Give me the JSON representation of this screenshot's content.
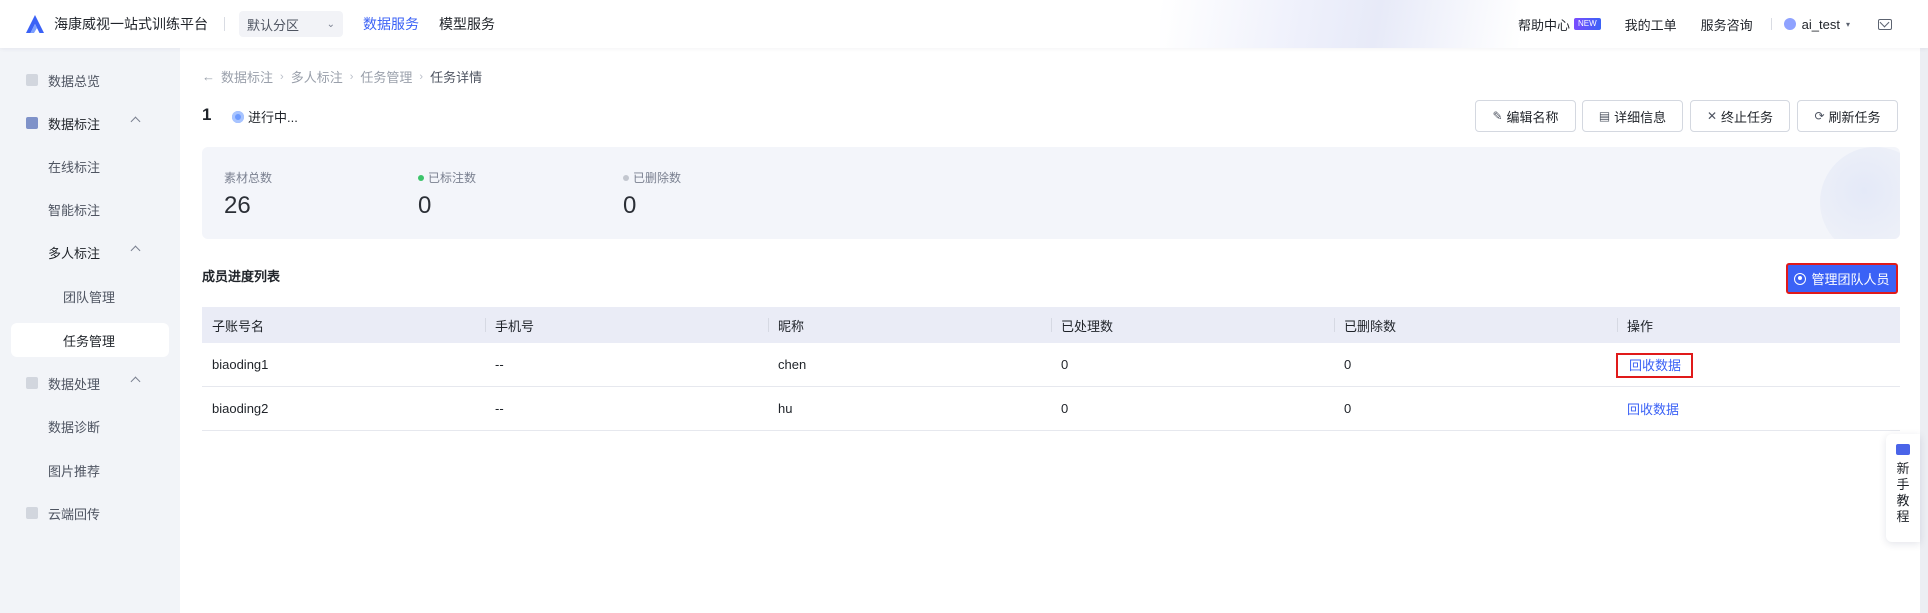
{
  "header": {
    "app_title": "海康威视一站式训练平台",
    "zone_select": "默认分区",
    "nav": [
      "数据服务",
      "模型服务"
    ],
    "help": "帮助中心",
    "help_badge": "NEW",
    "tickets": "我的工单",
    "consult": "服务咨询",
    "username": "ai_test",
    "accent": "#3b62f6"
  },
  "sidebar": {
    "items": [
      {
        "label": "数据总览",
        "icon": "grid-icon"
      },
      {
        "label": "数据标注",
        "icon": "tag-icon"
      },
      {
        "label": "在线标注"
      },
      {
        "label": "智能标注"
      },
      {
        "label": "多人标注"
      },
      {
        "label": "团队管理"
      },
      {
        "label": "任务管理"
      },
      {
        "label": "数据处理",
        "icon": "process-icon"
      },
      {
        "label": "数据诊断"
      },
      {
        "label": "图片推荐"
      },
      {
        "label": "云端回传",
        "icon": "cloud-icon"
      }
    ]
  },
  "breadcrumb": [
    "数据标注",
    "多人标注",
    "任务管理",
    "任务详情"
  ],
  "task": {
    "name": "1",
    "status": "进行中..."
  },
  "actions": {
    "edit": "编辑名称",
    "detail": "详细信息",
    "stop": "终止任务",
    "refresh": "刷新任务"
  },
  "stats": {
    "total_label": "素材总数",
    "total_value": "26",
    "labeled_label": "已标注数",
    "labeled_value": "0",
    "deleted_label": "已删除数",
    "deleted_value": "0",
    "labeled_color": "#3cc46a",
    "deleted_color": "#c3c7cf"
  },
  "members": {
    "title": "成员进度列表",
    "manage_button": "管理团队人员",
    "columns": [
      "子账号名",
      "手机号",
      "昵称",
      "已处理数",
      "已删除数",
      "操作"
    ],
    "rows": [
      [
        "biaoding1",
        "--",
        "chen",
        "0",
        "0",
        "回收数据"
      ],
      [
        "biaoding2",
        "--",
        "hu",
        "0",
        "0",
        "回收数据"
      ]
    ]
  },
  "tutorial": "新手教程"
}
